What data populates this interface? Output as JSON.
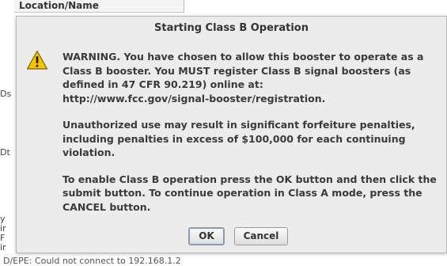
{
  "background": {
    "location_field": "Location/Name",
    "left_fragments": [
      "Ds",
      "Dt",
      "y",
      "ir",
      "F",
      "ir"
    ],
    "status_text": "D/EPE: Could not connect to 192.168.1.2"
  },
  "dialog": {
    "title": "Starting Class B Operation",
    "icon": "warning-triangle-icon",
    "paragraphs": [
      "WARNING.  You have chosen to allow this booster to operate as a\nClass B booster.  You MUST register Class B signal boosters (as\ndefined in 47 CFR 90.219) online at:\nhttp://www.fcc.gov/signal-booster/registration.",
      "Unauthorized use may result in significant forfeiture penalties,\nincluding penalties in excess of $100,000 for each continuing\nviolation.",
      "To enable Class B operation press the OK button and then click the\nsubmit button.  To continue operation in Class A mode, press  the\nCANCEL button."
    ],
    "ok_label": "OK",
    "cancel_label": "Cancel"
  },
  "colors": {
    "dialog_bg": "#ececec",
    "warning_fill": "#f5c400",
    "text": "#3a3a3a"
  }
}
